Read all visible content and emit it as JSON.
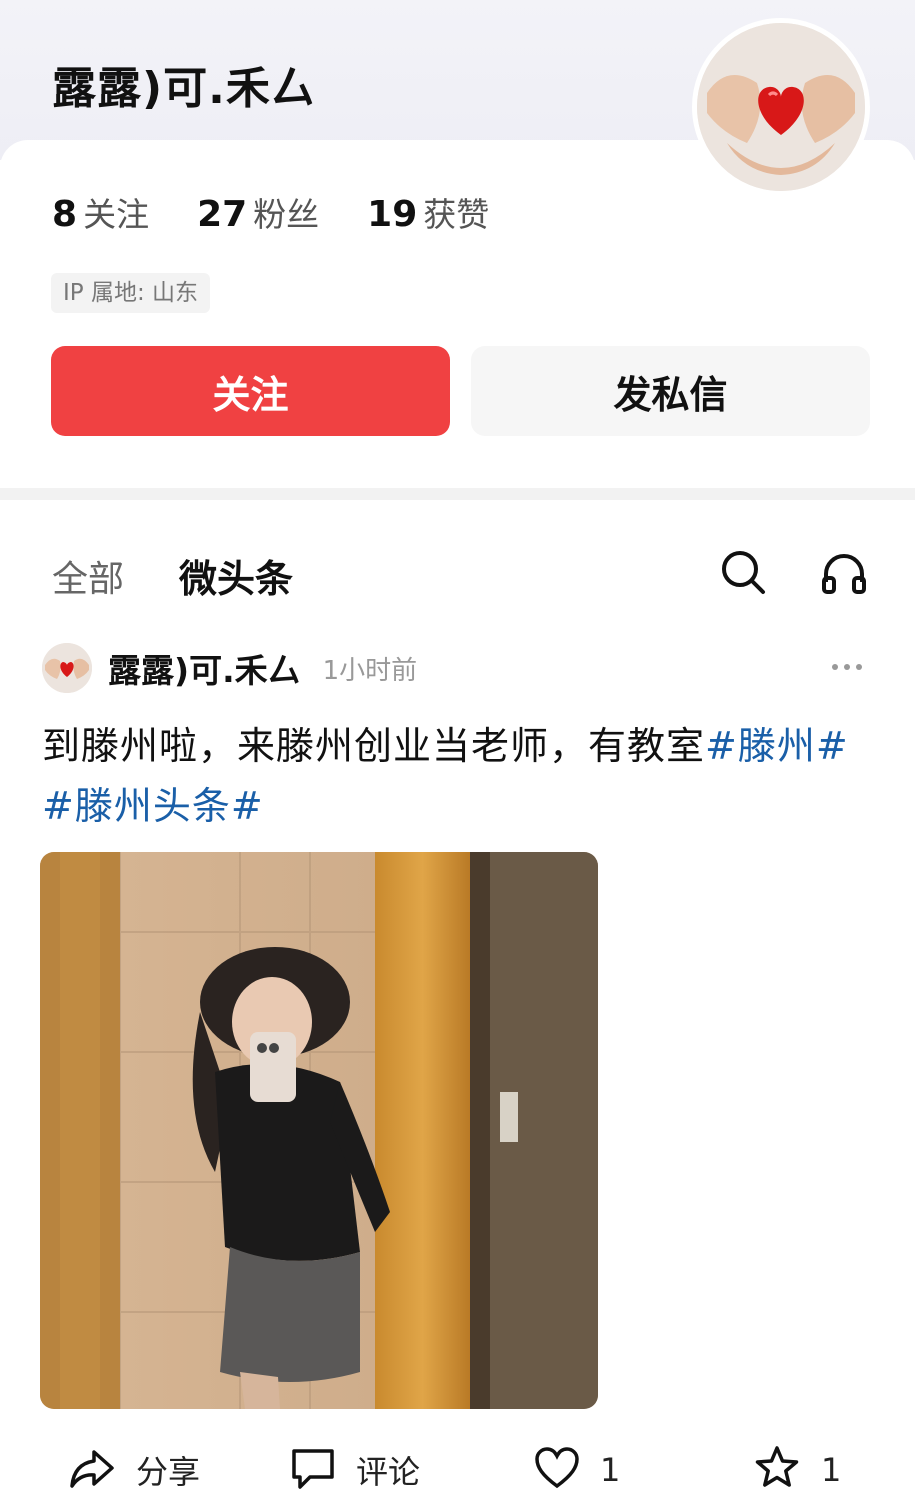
{
  "profile": {
    "name": "露露)可.禾厶",
    "stats": [
      {
        "num": "8",
        "label": "关注"
      },
      {
        "num": "27",
        "label": "粉丝"
      },
      {
        "num": "19",
        "label": "获赞"
      }
    ],
    "ip_location": "IP 属地: 山东",
    "follow_button": "关注",
    "message_button": "发私信"
  },
  "tabs": {
    "all": "全部",
    "micro": "微头条"
  },
  "icons": {
    "search": "search-icon",
    "listen": "headphones-icon",
    "more": "more-dots-icon",
    "share": "share-icon",
    "comment": "comment-icon",
    "like": "heart-icon",
    "favorite": "star-icon"
  },
  "post": {
    "author": "露露)可.禾厶",
    "time": "1小时前",
    "text": "到滕州啦，来滕州创业当老师，有教室",
    "hashtag1": "#滕州#",
    "hashtag2": "#滕州头条#"
  },
  "actions": {
    "share": "分享",
    "comment": "评论",
    "like_count": "1",
    "favorite_count": "1"
  },
  "colors": {
    "accent": "#f04142",
    "hashtag": "#1a5fa8"
  }
}
